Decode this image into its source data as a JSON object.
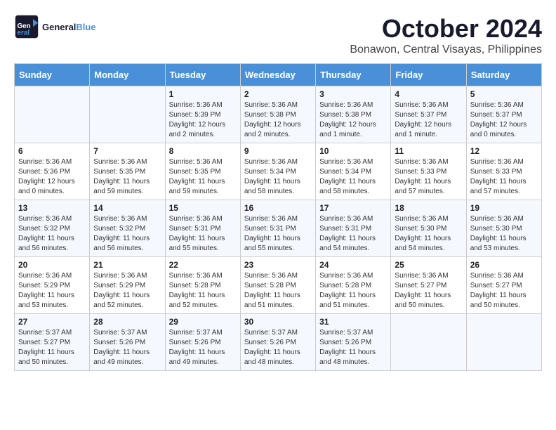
{
  "header": {
    "logo_general": "General",
    "logo_blue": "Blue",
    "month_title": "October 2024",
    "subtitle": "Bonawon, Central Visayas, Philippines"
  },
  "weekdays": [
    "Sunday",
    "Monday",
    "Tuesday",
    "Wednesday",
    "Thursday",
    "Friday",
    "Saturday"
  ],
  "weeks": [
    [
      null,
      null,
      {
        "day": 1,
        "sunrise": "5:36 AM",
        "sunset": "5:39 PM",
        "daylight": "12 hours and 2 minutes."
      },
      {
        "day": 2,
        "sunrise": "5:36 AM",
        "sunset": "5:38 PM",
        "daylight": "12 hours and 2 minutes."
      },
      {
        "day": 3,
        "sunrise": "5:36 AM",
        "sunset": "5:38 PM",
        "daylight": "12 hours and 1 minute."
      },
      {
        "day": 4,
        "sunrise": "5:36 AM",
        "sunset": "5:37 PM",
        "daylight": "12 hours and 1 minute."
      },
      {
        "day": 5,
        "sunrise": "5:36 AM",
        "sunset": "5:37 PM",
        "daylight": "12 hours and 0 minutes."
      }
    ],
    [
      {
        "day": 6,
        "sunrise": "5:36 AM",
        "sunset": "5:36 PM",
        "daylight": "12 hours and 0 minutes."
      },
      {
        "day": 7,
        "sunrise": "5:36 AM",
        "sunset": "5:35 PM",
        "daylight": "11 hours and 59 minutes."
      },
      {
        "day": 8,
        "sunrise": "5:36 AM",
        "sunset": "5:35 PM",
        "daylight": "11 hours and 59 minutes."
      },
      {
        "day": 9,
        "sunrise": "5:36 AM",
        "sunset": "5:34 PM",
        "daylight": "11 hours and 58 minutes."
      },
      {
        "day": 10,
        "sunrise": "5:36 AM",
        "sunset": "5:34 PM",
        "daylight": "11 hours and 58 minutes."
      },
      {
        "day": 11,
        "sunrise": "5:36 AM",
        "sunset": "5:33 PM",
        "daylight": "11 hours and 57 minutes."
      },
      {
        "day": 12,
        "sunrise": "5:36 AM",
        "sunset": "5:33 PM",
        "daylight": "11 hours and 57 minutes."
      }
    ],
    [
      {
        "day": 13,
        "sunrise": "5:36 AM",
        "sunset": "5:32 PM",
        "daylight": "11 hours and 56 minutes."
      },
      {
        "day": 14,
        "sunrise": "5:36 AM",
        "sunset": "5:32 PM",
        "daylight": "11 hours and 56 minutes."
      },
      {
        "day": 15,
        "sunrise": "5:36 AM",
        "sunset": "5:31 PM",
        "daylight": "11 hours and 55 minutes."
      },
      {
        "day": 16,
        "sunrise": "5:36 AM",
        "sunset": "5:31 PM",
        "daylight": "11 hours and 55 minutes."
      },
      {
        "day": 17,
        "sunrise": "5:36 AM",
        "sunset": "5:31 PM",
        "daylight": "11 hours and 54 minutes."
      },
      {
        "day": 18,
        "sunrise": "5:36 AM",
        "sunset": "5:30 PM",
        "daylight": "11 hours and 54 minutes."
      },
      {
        "day": 19,
        "sunrise": "5:36 AM",
        "sunset": "5:30 PM",
        "daylight": "11 hours and 53 minutes."
      }
    ],
    [
      {
        "day": 20,
        "sunrise": "5:36 AM",
        "sunset": "5:29 PM",
        "daylight": "11 hours and 53 minutes."
      },
      {
        "day": 21,
        "sunrise": "5:36 AM",
        "sunset": "5:29 PM",
        "daylight": "11 hours and 52 minutes."
      },
      {
        "day": 22,
        "sunrise": "5:36 AM",
        "sunset": "5:28 PM",
        "daylight": "11 hours and 52 minutes."
      },
      {
        "day": 23,
        "sunrise": "5:36 AM",
        "sunset": "5:28 PM",
        "daylight": "11 hours and 51 minutes."
      },
      {
        "day": 24,
        "sunrise": "5:36 AM",
        "sunset": "5:28 PM",
        "daylight": "11 hours and 51 minutes."
      },
      {
        "day": 25,
        "sunrise": "5:36 AM",
        "sunset": "5:27 PM",
        "daylight": "11 hours and 50 minutes."
      },
      {
        "day": 26,
        "sunrise": "5:36 AM",
        "sunset": "5:27 PM",
        "daylight": "11 hours and 50 minutes."
      }
    ],
    [
      {
        "day": 27,
        "sunrise": "5:37 AM",
        "sunset": "5:27 PM",
        "daylight": "11 hours and 50 minutes."
      },
      {
        "day": 28,
        "sunrise": "5:37 AM",
        "sunset": "5:26 PM",
        "daylight": "11 hours and 49 minutes."
      },
      {
        "day": 29,
        "sunrise": "5:37 AM",
        "sunset": "5:26 PM",
        "daylight": "11 hours and 49 minutes."
      },
      {
        "day": 30,
        "sunrise": "5:37 AM",
        "sunset": "5:26 PM",
        "daylight": "11 hours and 48 minutes."
      },
      {
        "day": 31,
        "sunrise": "5:37 AM",
        "sunset": "5:26 PM",
        "daylight": "11 hours and 48 minutes."
      },
      null,
      null
    ]
  ],
  "labels": {
    "sunrise": "Sunrise:",
    "sunset": "Sunset:",
    "daylight": "Daylight:"
  }
}
